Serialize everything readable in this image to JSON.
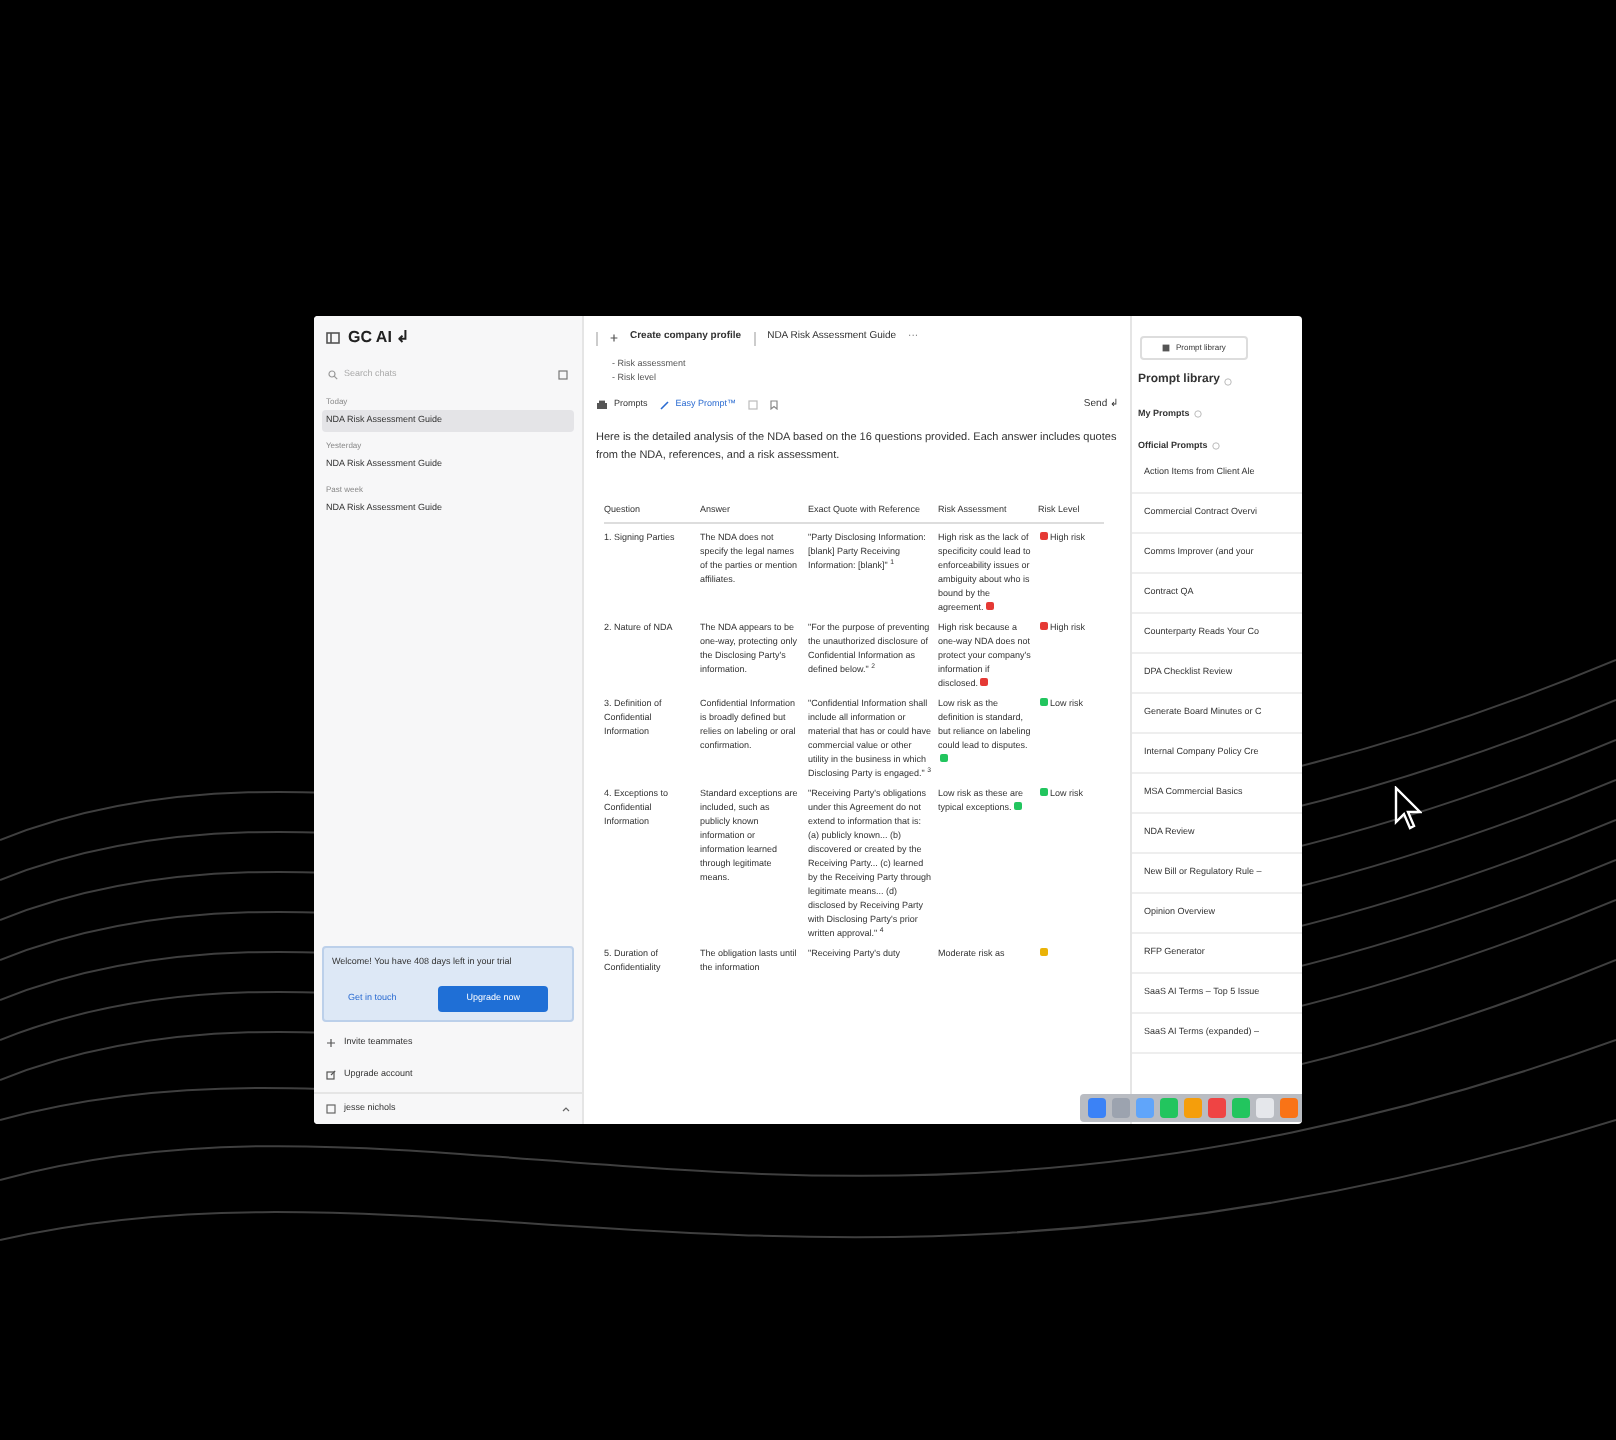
{
  "header": {
    "logo": "GC AI",
    "logo_mark": "↲",
    "create_button": "Create company profile",
    "breadcrumb": "NDA Risk Assessment Guide",
    "more": "···"
  },
  "sidebar": {
    "search": {
      "placeholder": "Search chats"
    },
    "groups": [
      {
        "label": "Today",
        "items": [
          {
            "label": "NDA Risk Assessment Guide",
            "selected": true
          }
        ]
      },
      {
        "label": "Yesterday",
        "items": [
          {
            "label": "NDA Risk Assessment Guide",
            "selected": false
          }
        ]
      },
      {
        "label": "Past week",
        "items": [
          {
            "label": "NDA Risk Assessment Guide",
            "selected": false
          }
        ]
      }
    ],
    "trial": {
      "message": "Welcome! You have 408 days left in your trial",
      "contact": "Get in touch",
      "upgrade": "Upgrade now"
    },
    "links": [
      "Invite teammates",
      "Upgrade account"
    ],
    "user": "jesse nichols"
  },
  "prompt_lines": [
    "- Risk assessment",
    "- Risk level"
  ],
  "toolbar": {
    "prompts": "Prompts",
    "easy_prompt": "Easy Prompt™",
    "send": "Send ↲"
  },
  "intro": "Here is the detailed analysis of the NDA based on the 16 questions provided. Each answer includes quotes from the NDA, references, and a risk assessment.",
  "table": {
    "columns": [
      "Question",
      "Answer",
      "Exact Quote with Reference",
      "Risk Assessment",
      "Risk Level"
    ],
    "rows": [
      {
        "question": "1. Signing Parties",
        "answer": "The NDA does not specify the legal names of the parties or mention affiliates.",
        "quote": "\"Party Disclosing Information: [blank] Party Receiving Information: [blank]\" $^{1}$",
        "assessment": "High risk as the lack of specificity could lead to enforceability issues or ambiguity about who is bound by the agreement.",
        "level": "High risk",
        "color": "#e53935"
      },
      {
        "question": "2. Nature of NDA",
        "answer": "The NDA appears to be one-way, protecting only the Disclosing Party's information.",
        "quote": "\"For the purpose of preventing the unauthorized disclosure of Confidential Information as defined below.\" $^{2}$",
        "assessment": "High risk because a one-way NDA does not protect your company's information if disclosed.",
        "level": "High risk",
        "color": "#e53935"
      },
      {
        "question": "3. Definition of Confidential Information",
        "answer": "Confidential Information is broadly defined but relies on labeling or oral confirmation.",
        "quote": "\"Confidential Information shall include all information or material that has or could have commercial value or other utility in the business in which Disclosing Party is engaged.\" $^{3}$",
        "assessment": "Low risk as the definition is standard, but reliance on labeling could lead to disputes.",
        "level": "Low risk",
        "color": "#22c55e"
      },
      {
        "question": "4. Exceptions to Confidential Information",
        "answer": "Standard exceptions are included, such as publicly known information or information learned through legitimate means.",
        "quote": "\"Receiving Party's obligations under this Agreement do not extend to information that is: (a) publicly known... (b) discovered or created by the Receiving Party... (c) learned by the Receiving Party through legitimate means... (d) disclosed by Receiving Party with Disclosing Party's prior written approval.\" $^{4}$",
        "assessment": "Low risk as these are typical exceptions.",
        "level": "Low risk",
        "color": "#22c55e"
      },
      {
        "question": "5. Duration of Confidentiality",
        "answer": "The obligation lasts until the information",
        "quote": "\"Receiving Party's duty",
        "assessment": "Moderate risk as",
        "level": "",
        "color": "#eab308"
      }
    ]
  },
  "prompt_panel": {
    "tab": "Prompt library",
    "title": "Prompt library",
    "sections": [
      "My Prompts",
      "Official Prompts"
    ],
    "items": [
      "Action Items from Client Ale",
      "Commercial Contract Overvi",
      "Comms Improver (and your",
      "Contract QA",
      "Counterparty Reads Your Co",
      "DPA Checklist Review",
      "Generate Board Minutes or C",
      "Internal Company Policy Cre",
      "MSA Commercial Basics",
      "NDA Review",
      "New Bill or Regulatory Rule –",
      "Opinion Overview",
      "RFP Generator",
      "SaaS AI Terms – Top 5 Issue",
      "SaaS AI Terms (expanded) –"
    ]
  }
}
